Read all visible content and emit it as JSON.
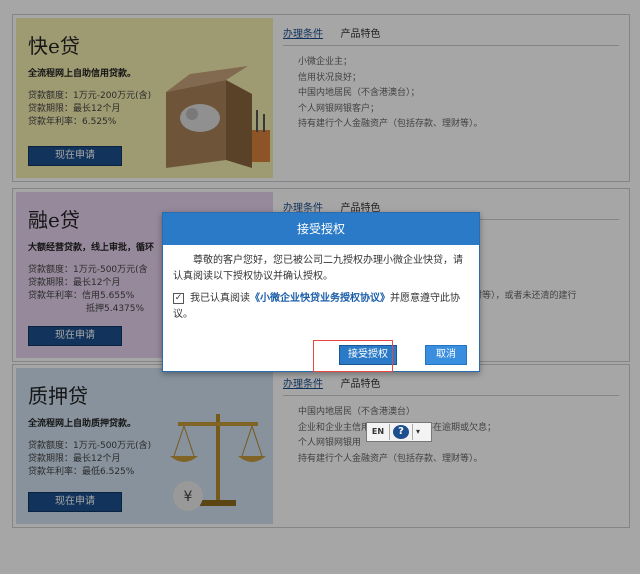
{
  "products": [
    {
      "title": "快e贷",
      "subtitle": "全流程网上自助信用贷款。",
      "lines": [
        "贷款额度：1万元-200万元(含)",
        "贷款期限：最长12个月",
        "贷款年利率：6.525%"
      ],
      "apply": "现在申请",
      "tabs": [
        "办理条件",
        "产品特色"
      ],
      "conditions": [
        "小微企业主；",
        "信用状况良好；",
        "中国内地居民（不含港澳台）；",
        "个人网银网银客户；",
        "持有建行个人金融资产（包括存款、理财等）。"
      ]
    },
    {
      "title": "融e贷",
      "subtitle": "大额经营贷款，线上审批，循环",
      "lines": [
        "贷款额度：1万元-500万元(含",
        "贷款期限：最长12个月",
        "贷款年利率：信用5.655%",
        "抵押5.4375%"
      ],
      "apply": "现在申请",
      "tabs": [
        "办理条件",
        "产品特色"
      ],
      "conditions": [
        "财等），或者未还清的建行"
      ]
    },
    {
      "title": "质押贷",
      "subtitle": "全流程网上自助质押贷款。",
      "lines": [
        "贷款额度：1万元-500万元(含)",
        "贷款期限：最长12个月",
        "贷款年利率：最低6.525%"
      ],
      "apply": "现在申请",
      "tabs": [
        "办理条件",
        "产品特色"
      ],
      "conditions": [
        "中国内地居民（不含港澳台）",
        "企业和企业主信用记录良好，不存在逾期或欠息；",
        "个人网银网银用",
        "持有建行个人金融资产（包括存款、理财等）。"
      ]
    }
  ],
  "modal": {
    "title": "接受授权",
    "body": "尊敬的客户您好，您已被公司二九授权办理小微企业快贷，请认真阅读以下授权协议并确认授权。",
    "check_mark": "✓",
    "check_prefix": "我已认真阅读",
    "agreement_link": "《小微企业快贷业务授权协议》",
    "check_suffix": "并愿意遵守此协议。",
    "accept": "接受授权",
    "cancel": "取消"
  },
  "ime": {
    "mode": "EN",
    "help": "?",
    "dropdown": "▾"
  },
  "colors": {
    "accent": "#2b7ac7",
    "highlight": "#e8463f"
  }
}
